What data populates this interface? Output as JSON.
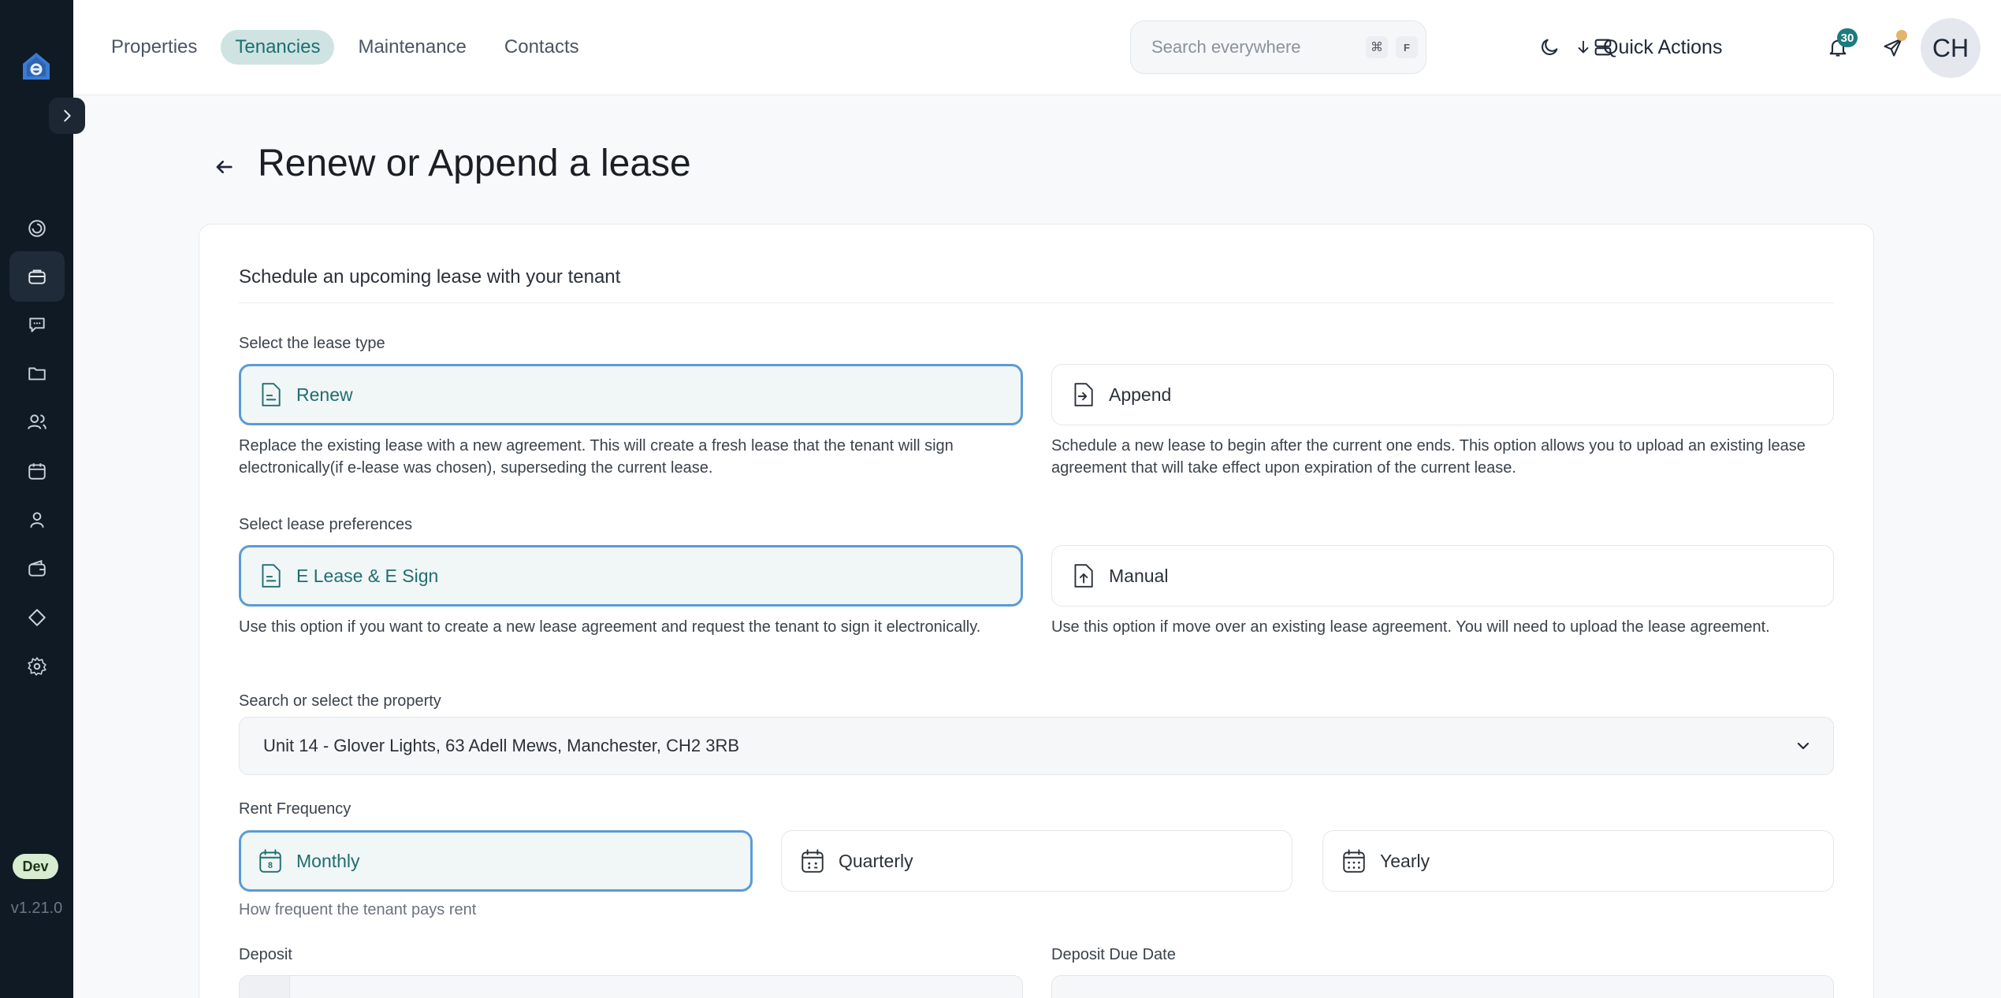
{
  "nav": {
    "tabs": [
      {
        "label": "Properties",
        "active": false
      },
      {
        "label": "Tenancies",
        "active": true
      },
      {
        "label": "Maintenance",
        "active": false
      },
      {
        "label": "Contacts",
        "active": false
      }
    ]
  },
  "search": {
    "placeholder": "Search everywhere",
    "shortcut_cmd": "⌘",
    "shortcut_key": "F"
  },
  "toolbar": {
    "quick_actions_label": "Quick Actions",
    "notification_count": "30"
  },
  "user": {
    "initials": "CH"
  },
  "sidebar": {
    "icons": [
      "dashboard-icon",
      "tenancies-icon",
      "messages-icon",
      "folder-icon",
      "contacts-icon",
      "calendar-icon",
      "person-icon",
      "wallet-icon",
      "tag-icon",
      "settings-icon"
    ],
    "active_index": 1,
    "env_badge": "Dev",
    "version": "v1.21.0"
  },
  "page": {
    "title": "Renew or Append a lease"
  },
  "form": {
    "card_title": "Schedule an upcoming lease with your tenant",
    "lease_type": {
      "label": "Select the lease type",
      "options": [
        {
          "label": "Renew",
          "selected": true,
          "desc": "Replace the existing lease with a new agreement. This will create a fresh lease that the tenant will sign electronically(if e-lease was chosen), superseding the current lease."
        },
        {
          "label": "Append",
          "selected": false,
          "desc": "Schedule a new lease to begin after the current one ends. This option allows you to upload an existing lease agreement that will take effect upon expiration of the current lease."
        }
      ]
    },
    "lease_pref": {
      "label": "Select lease preferences",
      "options": [
        {
          "label": "E Lease & E Sign",
          "selected": true,
          "desc": "Use this option if you want to create a new lease agreement and request the tenant to sign it electronically."
        },
        {
          "label": "Manual",
          "selected": false,
          "desc": "Use this option if move over an existing lease agreement. You will need to upload the lease agreement."
        }
      ]
    },
    "property": {
      "label": "Search or select the property",
      "value": "Unit 14 - Glover Lights, 63 Adell Mews, Manchester, CH2 3RB"
    },
    "rent_frequency": {
      "label": "Rent Frequency",
      "options": [
        {
          "label": "Monthly",
          "selected": true
        },
        {
          "label": "Quarterly",
          "selected": false
        },
        {
          "label": "Yearly",
          "selected": false
        }
      ],
      "helper": "How frequent the tenant pays rent"
    },
    "deposit": {
      "label": "Deposit"
    },
    "deposit_due": {
      "label": "Deposit Due Date"
    }
  },
  "colors": {
    "accent": "#1d7b7d",
    "selected_border": "#5b9bd5",
    "sidebar_bg": "#101a24"
  }
}
